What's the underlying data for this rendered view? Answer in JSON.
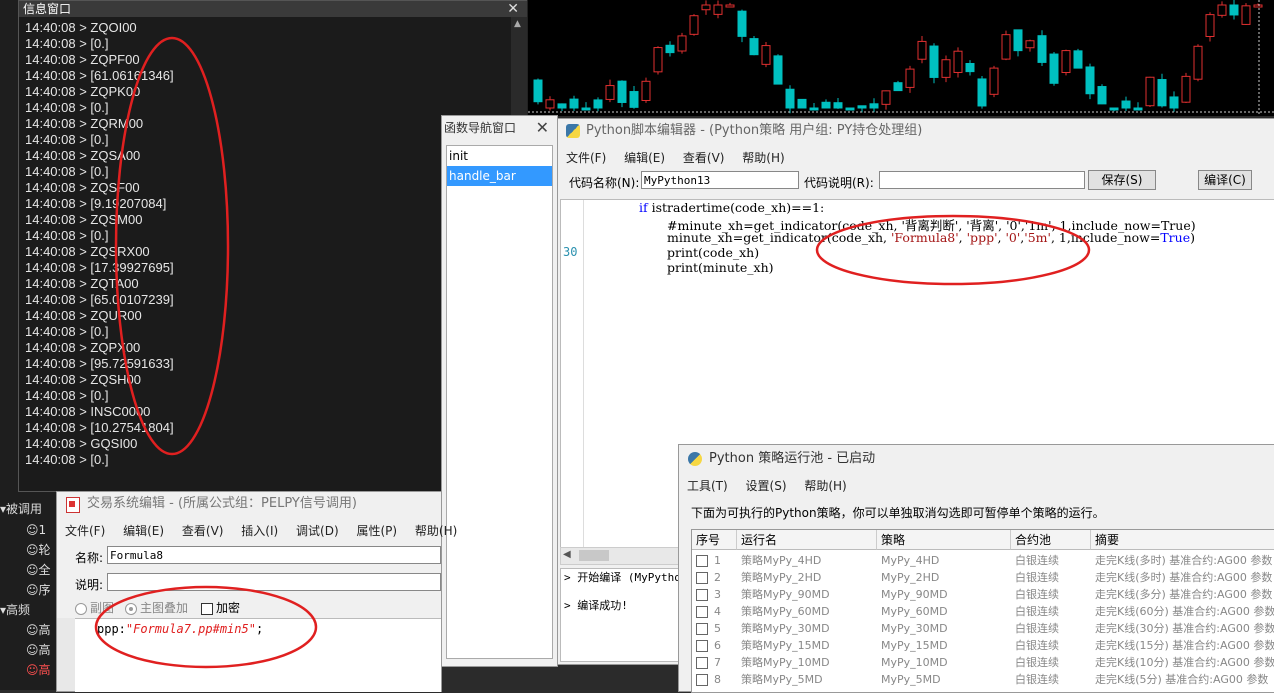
{
  "info_window": {
    "title": "信息窗口",
    "lines": [
      "14:40:08 > ZQOI00",
      "14:40:08 > [0.]",
      "14:40:08 > ZQPF00",
      "14:40:08 > [61.06161346]",
      "14:40:08 > ZQPK00",
      "14:40:08 > [0.]",
      "14:40:08 > ZQRM00",
      "14:40:08 > [0.]",
      "14:40:08 > ZQSA00",
      "14:40:08 > [0.]",
      "14:40:08 > ZQSF00",
      "14:40:08 > [9.19207084]",
      "14:40:08 > ZQSM00",
      "14:40:08 > [0.]",
      "14:40:08 > ZQSRX00",
      "14:40:08 > [17.39927695]",
      "14:40:08 > ZQTA00",
      "14:40:08 > [65.00107239]",
      "14:40:08 > ZQUR00",
      "14:40:08 > [0.]",
      "14:40:08 > ZQPX00",
      "14:40:08 > [95.72591633]",
      "14:40:08 > ZQSH00",
      "14:40:08 > [0.]",
      "14:40:08 > INSC0000",
      "14:40:08 > [10.27541804]",
      "14:40:08 > GQSI00",
      "14:40:08 > [0.]"
    ]
  },
  "tree": {
    "items": [
      "被调用",
      "1",
      "轮",
      "全",
      "序",
      "高频",
      "高",
      "高",
      "高"
    ]
  },
  "func_nav": {
    "title": "函数导航窗口",
    "items": [
      "init",
      "handle_bar"
    ]
  },
  "python_editor": {
    "title": "Python脚本编辑器 - (Python策略 用户组: PY持仓处理组)",
    "menu": [
      "文件(F)",
      "编辑(E)",
      "查看(V)",
      "帮助(H)"
    ],
    "code_name_label": "代码名称(N):",
    "code_name_value": "MyPython13",
    "code_desc_label": "代码说明(R):",
    "code_desc_value": "",
    "save_label": "保存(S)",
    "compile_label": "编译(C)",
    "line_number": "30",
    "code": {
      "l1_kw": "if",
      "l1_rest": " istradertime(code_xh)==1:",
      "l2_comment": "#minute_xh=get_indicator(code_xh, '背离判断', '背离', '0','1m', 1,include_now=True)",
      "l3_a": "minute_xh=get_indicator(code_xh, ",
      "l3_s1": "'Formula8'",
      "l3_b": ", ",
      "l3_s2": "'ppp'",
      "l3_c": ", ",
      "l3_s3": "'0'",
      "l3_d": ",",
      "l3_s4": "'5m'",
      "l3_e": ", 1,include_now=",
      "l3_kw": "True",
      "l3_f": ")",
      "l4": "print(code_xh)",
      "l5": "print(minute_xh)"
    },
    "output": [
      "> 开始编译 (MyPytho",
      "",
      "> 编译成功!"
    ]
  },
  "pool": {
    "title": "Python 策略运行池 - 已启动",
    "menu": [
      "工具(T)",
      "设置(S)",
      "帮助(H)"
    ],
    "description": "下面为可执行的Python策略，你可以单独取消勾选即可暂停单个策略的运行。",
    "columns": [
      "序号",
      "运行名",
      "策略",
      "合约池",
      "摘要"
    ],
    "rows": [
      {
        "no": "1",
        "name": "策略MyPy_4HD",
        "strategy": "MyPy_4HD",
        "pool": "白银连续",
        "summary": "走完K线(多时) 基准合约:AG00 参数"
      },
      {
        "no": "2",
        "name": "策略MyPy_2HD",
        "strategy": "MyPy_2HD",
        "pool": "白银连续",
        "summary": "走完K线(多时) 基准合约:AG00 参数"
      },
      {
        "no": "3",
        "name": "策略MyPy_90MD",
        "strategy": "MyPy_90MD",
        "pool": "白银连续",
        "summary": "走完K线(多分) 基准合约:AG00 参数"
      },
      {
        "no": "4",
        "name": "策略MyPy_60MD",
        "strategy": "MyPy_60MD",
        "pool": "白银连续",
        "summary": "走完K线(60分) 基准合约:AG00 参数"
      },
      {
        "no": "5",
        "name": "策略MyPy_30MD",
        "strategy": "MyPy_30MD",
        "pool": "白银连续",
        "summary": "走完K线(30分) 基准合约:AG00 参数"
      },
      {
        "no": "6",
        "name": "策略MyPy_15MD",
        "strategy": "MyPy_15MD",
        "pool": "白银连续",
        "summary": "走完K线(15分) 基准合约:AG00 参数"
      },
      {
        "no": "7",
        "name": "策略MyPy_10MD",
        "strategy": "MyPy_10MD",
        "pool": "白银连续",
        "summary": "走完K线(10分) 基准合约:AG00 参数"
      },
      {
        "no": "8",
        "name": "策略MyPy_5MD",
        "strategy": "MyPy_5MD",
        "pool": "白银连续",
        "summary": "走完K线(5分) 基准合约:AG00 参数"
      }
    ]
  },
  "trade_editor": {
    "title": "交易系统编辑 - (所属公式组：PELPY信号调用)",
    "menu": [
      "文件(F)",
      "编辑(E)",
      "查看(V)",
      "插入(I)",
      "调试(D)",
      "属性(P)",
      "帮助(H)"
    ],
    "name_label": "名称:",
    "name_value": "Formula8",
    "desc_label": "说明:",
    "desc_value": "",
    "opt_sub": "副图",
    "opt_main": "主图叠加",
    "opt_encrypt": "加密",
    "code_prefix": "ppp:",
    "code_string": "\"Formula7.pp#min5\"",
    "code_suffix": ";"
  },
  "colors": {
    "annotation_red": "#e02020",
    "candle_up": "#e03030",
    "candle_down": "#00c0c0",
    "selection_blue": "#3399ff"
  }
}
